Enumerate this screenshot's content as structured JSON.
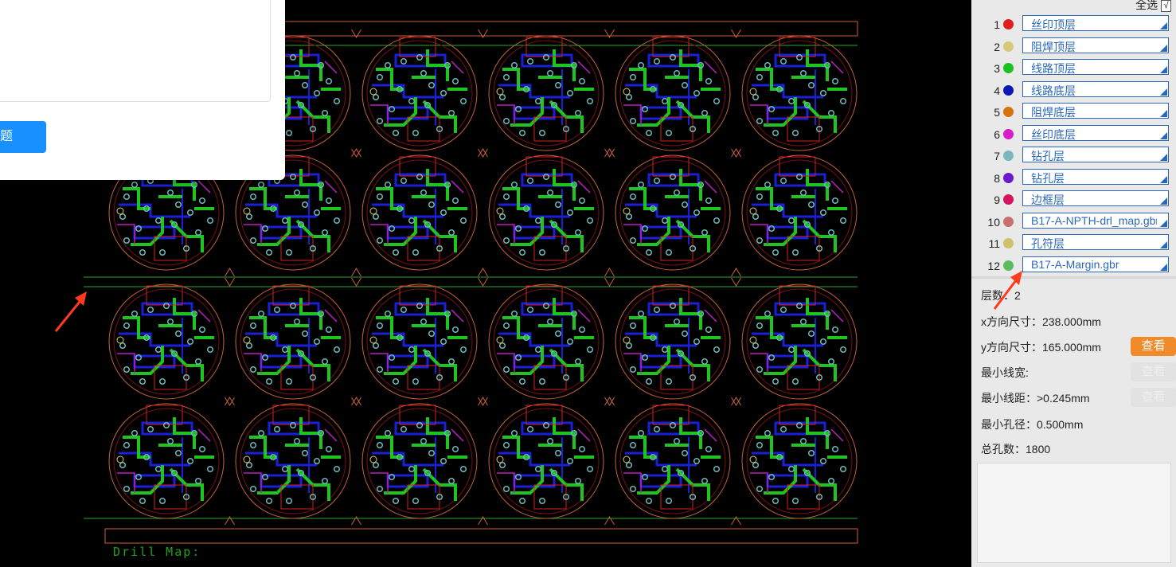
{
  "viewer": {
    "drill_map_label": "Drill Map:",
    "panel": {
      "rows": 4,
      "cols": 6
    }
  },
  "dialog": {
    "button_label": "题"
  },
  "sidebar": {
    "select_all_label": "全选",
    "select_all_checked": true,
    "select_all_check_glyph": "√",
    "layers": [
      {
        "num": "1",
        "name": "丝印顶层",
        "color": "#e01e1e"
      },
      {
        "num": "2",
        "name": "阻焊顶层",
        "color": "#d8c87a"
      },
      {
        "num": "3",
        "name": "线路顶层",
        "color": "#19c21e"
      },
      {
        "num": "4",
        "name": "线路底层",
        "color": "#0a18b8"
      },
      {
        "num": "5",
        "name": "阻焊底层",
        "color": "#d8720e"
      },
      {
        "num": "6",
        "name": "丝印底层",
        "color": "#d61fc8"
      },
      {
        "num": "7",
        "name": "钻孔层",
        "color": "#7ab8c0"
      },
      {
        "num": "8",
        "name": "钻孔层",
        "color": "#6a1ac8"
      },
      {
        "num": "9",
        "name": "边框层",
        "color": "#d4145e"
      },
      {
        "num": "10",
        "name": "B17-A-NPTH-drl_map.gbr",
        "color": "#c87070"
      },
      {
        "num": "11",
        "name": "孔符层",
        "color": "#cfc06a"
      },
      {
        "num": "12",
        "name": "B17-A-Margin.gbr",
        "color": "#5cbb5c"
      }
    ],
    "info": {
      "layer_count": "层数：2",
      "x_size": "x方向尺寸：238.000mm",
      "y_size": "y方向尺寸：165.000mm",
      "min_trace_width": "最小线宽:",
      "min_trace_spacing": "最小线距：>0.245mm",
      "min_hole": "最小孔径：0.500mm",
      "total_holes": "总孔数：1800"
    },
    "view_button_label": "查看"
  },
  "colors": {
    "accent_orange": "#f08a2a",
    "link_blue": "#2a67b8",
    "primary_blue": "#1890ff",
    "annotation_red": "#ff3b1f"
  }
}
